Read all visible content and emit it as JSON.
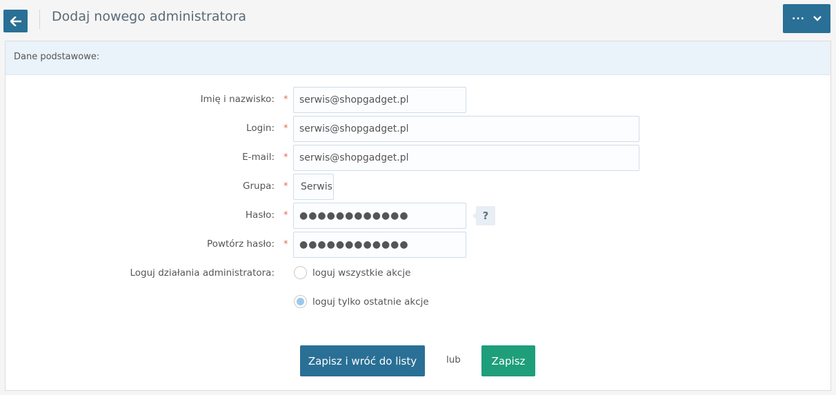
{
  "header": {
    "title": "Dodaj nowego administratora",
    "back_icon": "arrow-left-icon",
    "more_label": "...",
    "more_icon": "chevron-down-icon"
  },
  "panel": {
    "title": "Dane podstawowe:"
  },
  "form": {
    "name": {
      "label": "Imię i nazwisko:",
      "required": "*",
      "value": "serwis@shopgadget.pl"
    },
    "login": {
      "label": "Login:",
      "required": "*",
      "value": "serwis@shopgadget.pl"
    },
    "email": {
      "label": "E-mail:",
      "required": "*",
      "value": "serwis@shopgadget.pl"
    },
    "group": {
      "label": "Grupa:",
      "required": "*",
      "value": "Serwis"
    },
    "password": {
      "label": "Hasło:",
      "required": "*",
      "value": "●●●●●●●●●●●●",
      "help": "?"
    },
    "password_repeat": {
      "label": "Powtórz hasło:",
      "required": "*",
      "value": "●●●●●●●●●●●●"
    },
    "log": {
      "label": "Loguj działania administratora:",
      "options": [
        {
          "label": "loguj wszystkie akcje",
          "checked": false
        },
        {
          "label": "loguj tylko ostatnie akcje",
          "checked": true
        }
      ]
    }
  },
  "actions": {
    "save_and_return": "Zapisz i wróć do listy",
    "or": "lub",
    "save": "Zapisz"
  },
  "colors": {
    "primary": "#2a6f95",
    "success": "#1e9e7a",
    "required": "#e26a4a",
    "panel_header": "#eaf2fa"
  }
}
